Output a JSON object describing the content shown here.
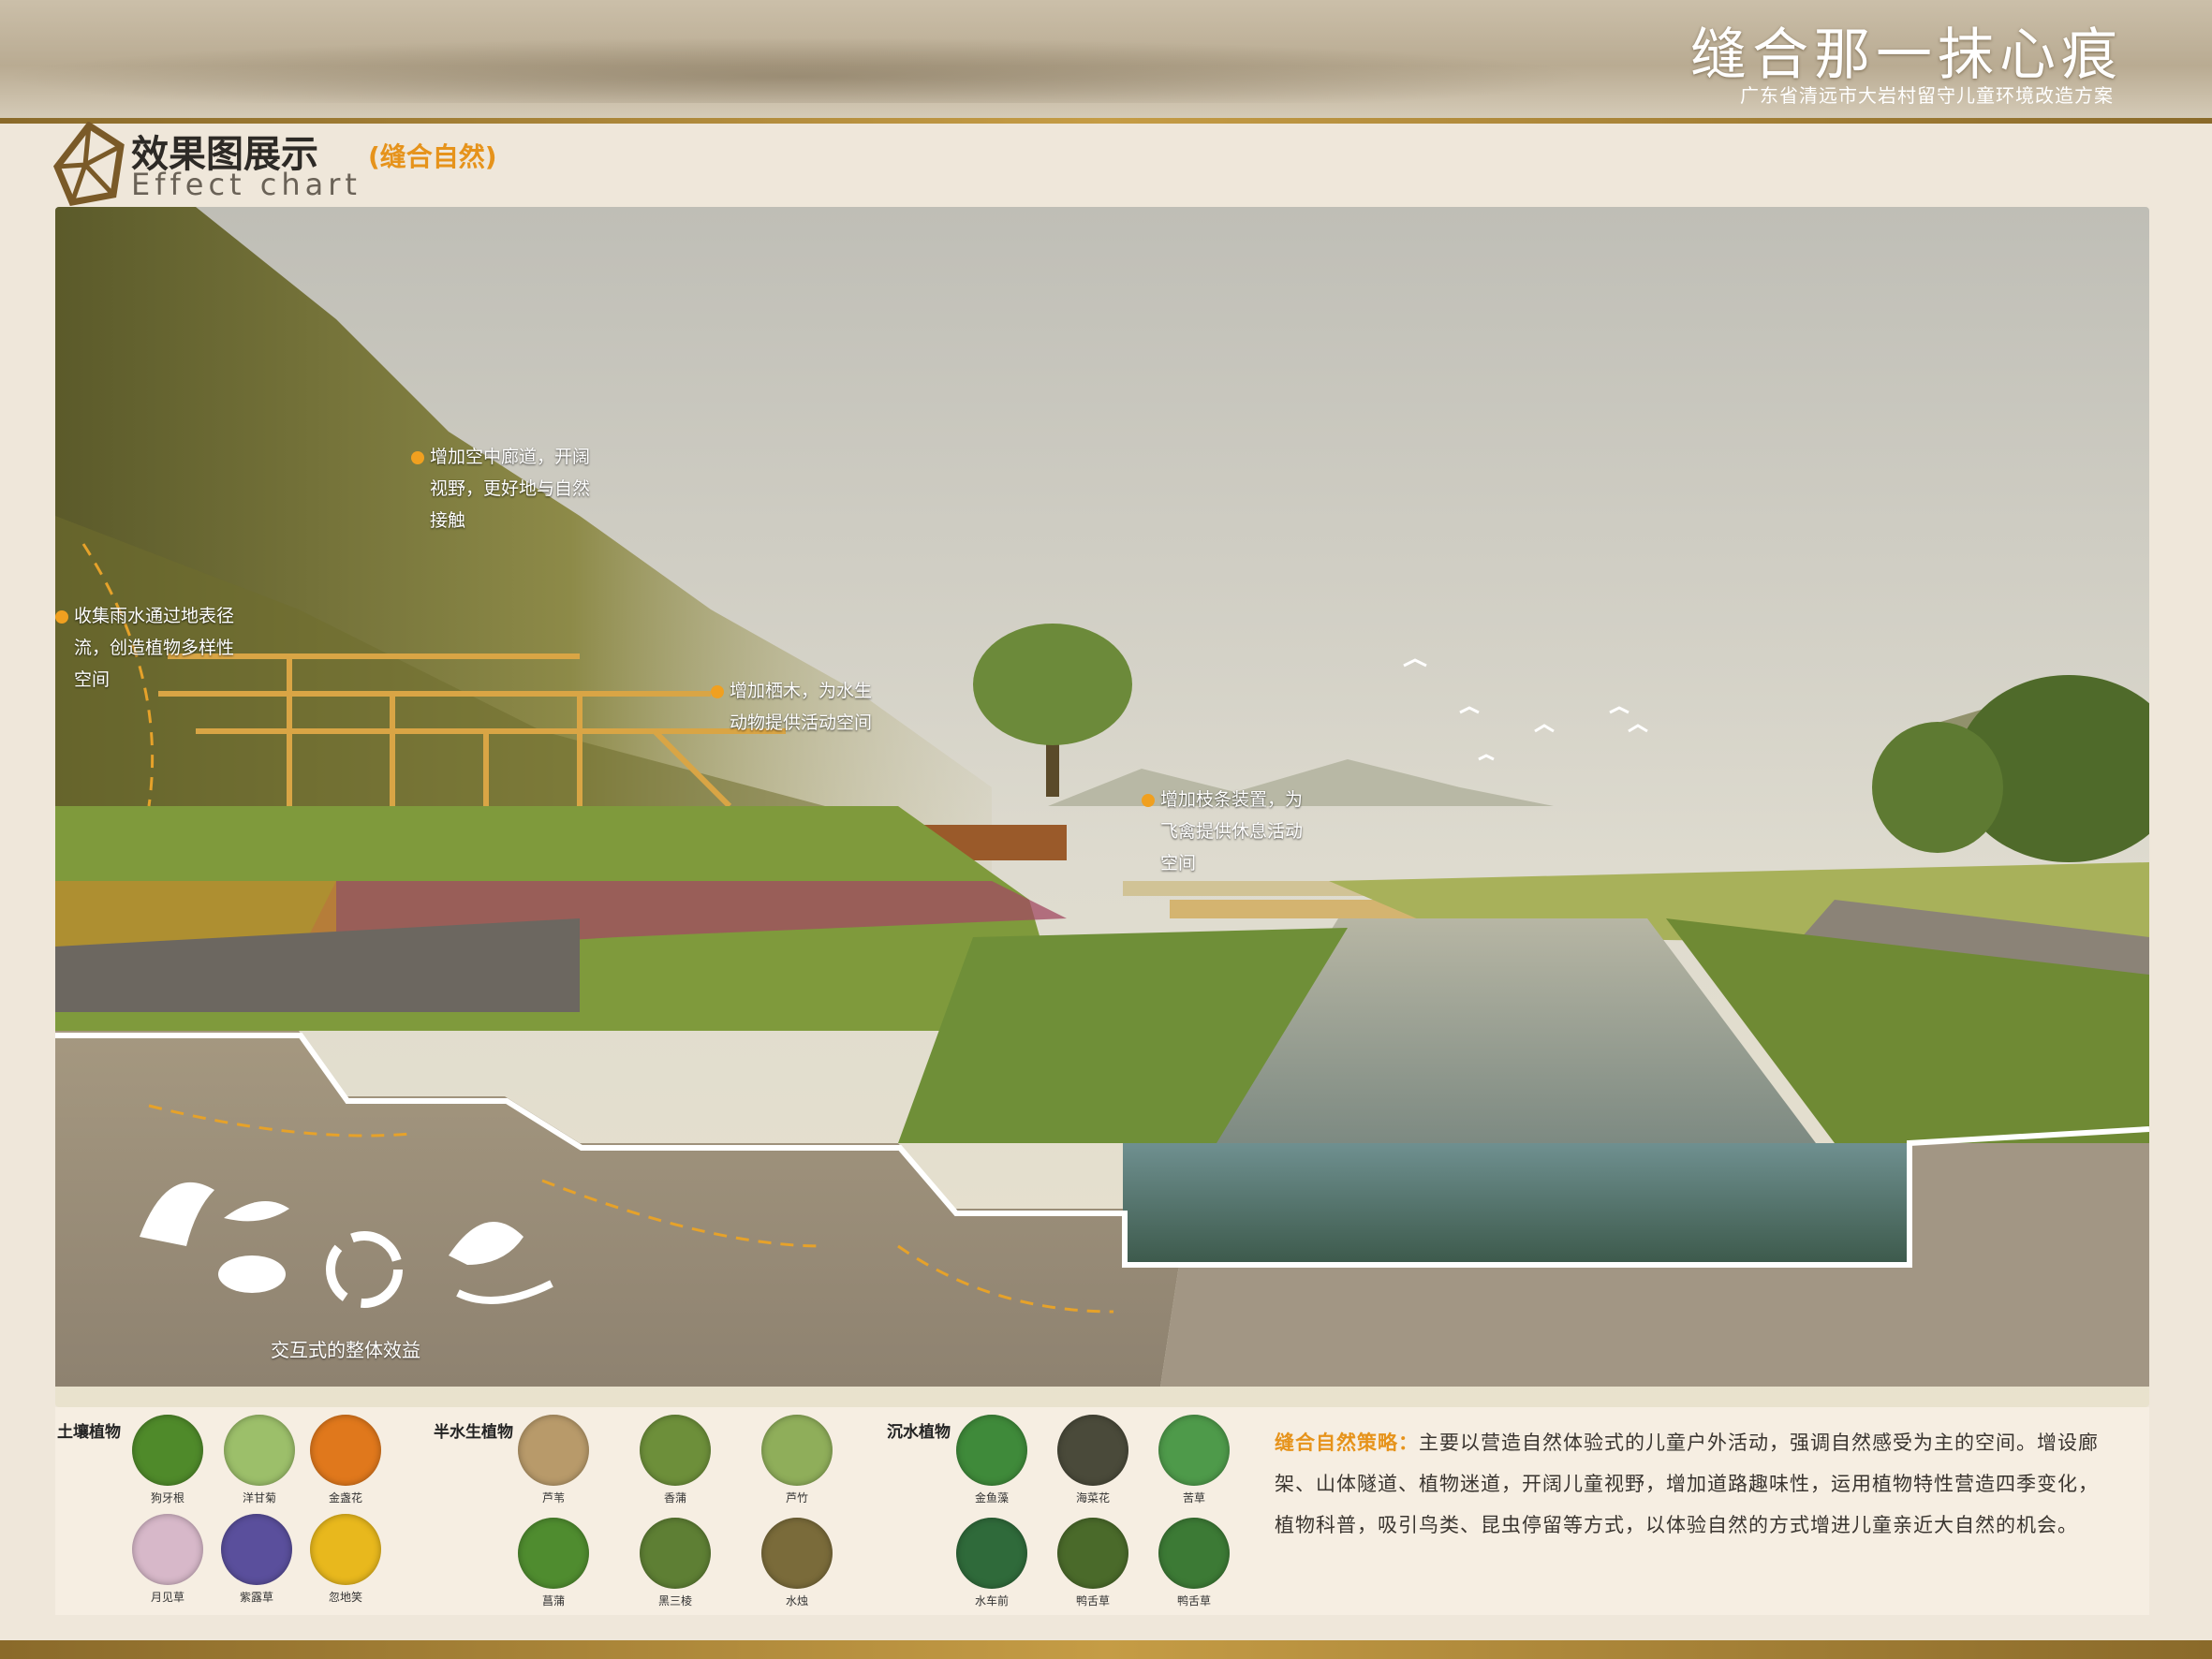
{
  "header": {
    "title": "缝合那一抹心痕",
    "subtitle": "广东省清远市大岩村留守儿童环境改造方案"
  },
  "section": {
    "title": "效果图展示",
    "tag": "(缝合自然)",
    "title_en": "Effect chart"
  },
  "callouts": [
    {
      "lines": [
        "增加空中廊道，开阔",
        "视野，更好地与自然",
        "接触"
      ]
    },
    {
      "lines": [
        "收集雨水通过地表径",
        "流，创造植物多样性",
        "空间"
      ]
    },
    {
      "lines": [
        "增加栖木，为水生",
        "动物提供活动空间"
      ]
    },
    {
      "lines": [
        "增加枝条装置，为",
        "飞禽提供休息活动",
        "空间"
      ]
    }
  ],
  "benefit_label": "交互式的整体效益",
  "plant_groups": [
    {
      "title": "土壤植物",
      "plants": [
        {
          "name": "狗牙根",
          "color": "#4f8a2a"
        },
        {
          "name": "洋甘菊",
          "color": "#9cbf6a"
        },
        {
          "name": "金盏花",
          "color": "#e0781c"
        },
        {
          "name": "月见草",
          "color": "#d7b8c9"
        },
        {
          "name": "紫露草",
          "color": "#5a4f9c"
        },
        {
          "name": "忽地笑",
          "color": "#e8b81d"
        }
      ]
    },
    {
      "title": "半水生植物",
      "plants": [
        {
          "name": "芦苇",
          "color": "#b89a6a"
        },
        {
          "name": "香蒲",
          "color": "#6d8f3a"
        },
        {
          "name": "芦竹",
          "color": "#8fae5a"
        },
        {
          "name": "菖蒲",
          "color": "#4f8c2f"
        },
        {
          "name": "黑三棱",
          "color": "#5e7f34"
        },
        {
          "name": "水烛",
          "color": "#7a6b3a"
        }
      ]
    },
    {
      "title": "沉水植物",
      "plants": [
        {
          "name": "金鱼藻",
          "color": "#3f8a3a"
        },
        {
          "name": "海菜花",
          "color": "#4a4a3a"
        },
        {
          "name": "苦草",
          "color": "#4e9a4a"
        },
        {
          "name": "水车前",
          "color": "#2f6a3a"
        },
        {
          "name": "鸭舌草",
          "color": "#4a6a2a"
        },
        {
          "name": "鸭舌草",
          "color": "#3c7a35"
        }
      ]
    }
  ],
  "strategy": {
    "lead": "缝合自然策略：",
    "text": "主要以营造自然体验式的儿童户外活动，强调自然感受为主的空间。增设廊架、山体隧道、植物迷道，开阔儿童视野，增加道路趣味性，运用植物特性营造四季变化，植物科普，吸引鸟类、昆虫停留等方式，以体验自然的方式增进儿童亲近大自然的机会。"
  },
  "colors": {
    "accent": "#e6931b",
    "gold": "#c59c45"
  }
}
